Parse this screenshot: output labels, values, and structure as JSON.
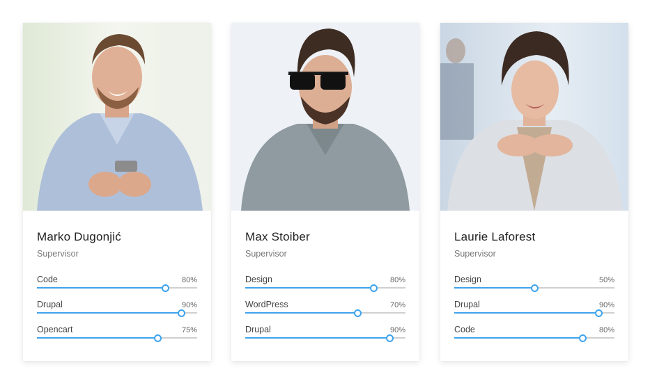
{
  "team": [
    {
      "name": "Marko Dugonjić",
      "role": "Supervisor",
      "photo_icon": "person-photo",
      "skills": [
        {
          "label": "Code",
          "value_text": "80%",
          "value": 80
        },
        {
          "label": "Drupal",
          "value_text": "90%",
          "value": 90
        },
        {
          "label": "Opencart",
          "value_text": "75%",
          "value": 75
        }
      ]
    },
    {
      "name": "Max Stoiber",
      "role": "Supervisor",
      "photo_icon": "person-photo",
      "skills": [
        {
          "label": "Design",
          "value_text": "80%",
          "value": 80
        },
        {
          "label": "WordPress",
          "value_text": "70%",
          "value": 70
        },
        {
          "label": "Drupal",
          "value_text": "90%",
          "value": 90
        }
      ]
    },
    {
      "name": "Laurie Laforest",
      "role": "Supervisor",
      "photo_icon": "person-photo",
      "skills": [
        {
          "label": "Design",
          "value_text": "50%",
          "value": 50
        },
        {
          "label": "Drupal",
          "value_text": "90%",
          "value": 90
        },
        {
          "label": "Code",
          "value_text": "80%",
          "value": 80
        }
      ]
    }
  ],
  "colors": {
    "accent": "#3ea3ec",
    "track": "#cfcfcf",
    "name": "#222222",
    "muted": "#777777"
  }
}
